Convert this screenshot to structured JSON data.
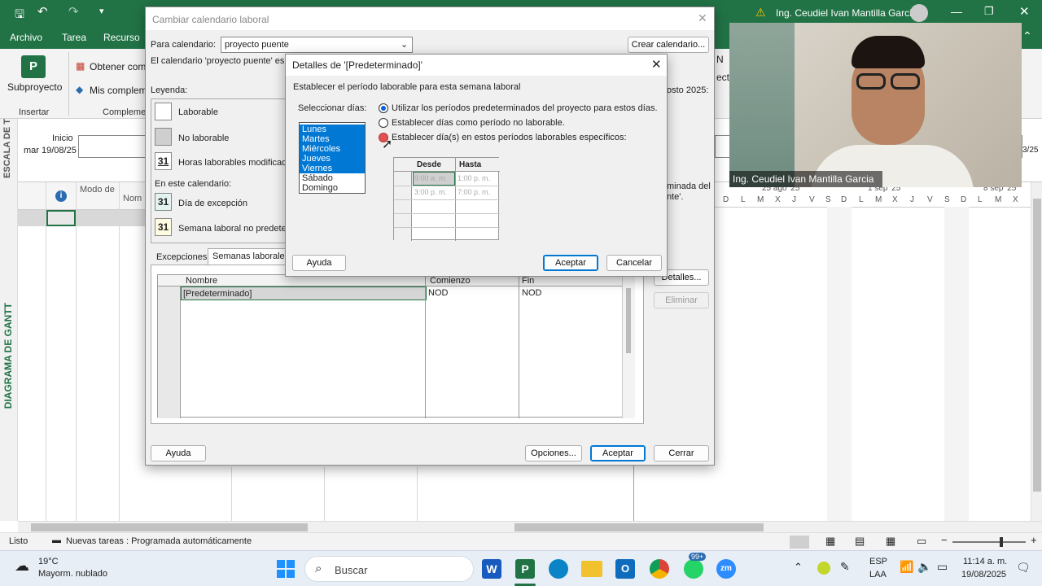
{
  "titlebar": {
    "warning_text": "Ing. Ceudiel Ivan Mantilla Garcia"
  },
  "tabs": [
    "Archivo",
    "Tarea",
    "Recurso"
  ],
  "ribbon": {
    "subproyecto": "Subproyecto",
    "obtener": "Obtener comp",
    "mis_complem": "Mis complem",
    "insertar": "Insertar",
    "complem": "Compleme"
  },
  "timeline": {
    "label": "ESCALA DE T",
    "inicio": "Inicio",
    "inicio_date": "mar 19/08/25",
    "right_date": "3/25"
  },
  "grid": {
    "col_modo": "Modo de",
    "col_nom": "Nom"
  },
  "gantt": {
    "week1": "25 ago '25",
    "week2": "1 sep '25",
    "week3": "8 sep '25",
    "days": [
      "D",
      "L",
      "M",
      "X",
      "J",
      "V",
      "S",
      "D",
      "L",
      "M",
      "X",
      "J",
      "V",
      "S",
      "D",
      "L",
      "M",
      "X"
    ]
  },
  "gantt_side_label": "DIAGRAMA DE GANTT",
  "main_dialog": {
    "title": "Cambiar calendario laboral",
    "para_label": "Para calendario:",
    "para_value": "proyecto puente",
    "crear_btn": "Crear calendario...",
    "desc": "El calendario 'proyecto puente' es",
    "leyenda": "Leyenda:",
    "laborable": "Laborable",
    "no_laborable": "No laborable",
    "horas_mod": "Horas laborables modificad",
    "en_este": "En este calendario:",
    "dia_excepcion": "Día de excepción",
    "semana_no": "Semana laboral no predeter",
    "cal_num": "31",
    "right_text1": "osto 2025:",
    "right_text2": "minada del",
    "right_text3": "nte'.",
    "tab_excepciones": "Excepciones",
    "tab_semanas": "Semanas laborales",
    "table_headers": [
      "Nombre",
      "Comienzo",
      "Fin"
    ],
    "table_row": [
      "[Predeterminado]",
      "NOD",
      "NOD"
    ],
    "detalles_btn": "Detalles...",
    "eliminar_btn": "Eliminar",
    "ayuda_btn": "Ayuda",
    "opciones_btn": "Opciones...",
    "aceptar_btn": "Aceptar",
    "cerrar_btn": "Cerrar"
  },
  "detail_dialog": {
    "title": "Detalles de '[Predeterminado]'",
    "subtitle": "Establecer el período laborable para esta semana laboral",
    "select_days": "Seleccionar días:",
    "days": [
      "Lunes",
      "Martes",
      "Miércoles",
      "Jueves",
      "Viernes",
      "Sábado",
      "Domingo"
    ],
    "selected_count": 5,
    "opt1": "Utilizar los períodos predeterminados del proyecto para estos días.",
    "opt2": "Establecer días como período no laborable.",
    "opt3": "Establecer día(s) en estos períodos laborables específicos:",
    "time_headers": [
      "Desde",
      "Hasta"
    ],
    "times": [
      [
        "9:00 a. m.",
        "1:00 p. m."
      ],
      [
        "3:00 p. m.",
        "7:00 p. m."
      ]
    ],
    "ayuda_btn": "Ayuda",
    "aceptar_btn": "Aceptar",
    "cancelar_btn": "Cancelar"
  },
  "webcam": {
    "name": "Ing. Ceudiel  Ivan Mantilla Garcia"
  },
  "status": {
    "listo": "Listo",
    "nuevas": "Nuevas tareas : Programada automáticamente"
  },
  "taskbar": {
    "temp": "19°C",
    "weather": "Mayorm. nublado",
    "search": "Buscar",
    "lang1": "ESP",
    "lang2": "LAA",
    "time": "11:14 a. m.",
    "date": "19/08/2025",
    "badge": "99+"
  }
}
